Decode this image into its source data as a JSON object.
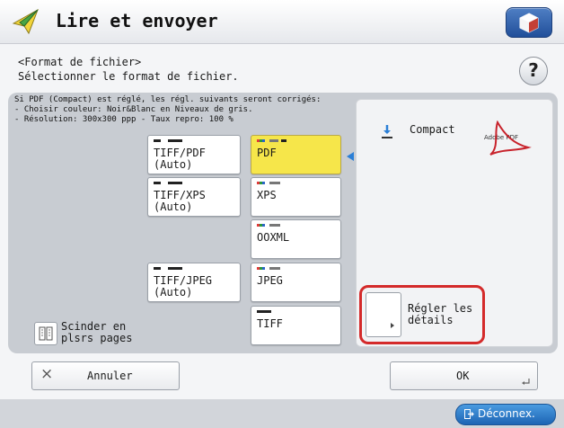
{
  "app": {
    "title": "Lire et envoyer"
  },
  "header": {
    "title": "<Format de fichier>",
    "subtitle": "Sélectionner le format de fichier.",
    "help_label": "?"
  },
  "info": {
    "line1": "Si PDF (Compact) est réglé, les régl. suivants seront corrigés:",
    "line2": "- Choisir couleur: Noir&Blanc en Niveaux de gris.",
    "line3": "- Résolution: 300x300 ppp - Taux repro: 100 %"
  },
  "formats": {
    "tiff_pdf": "TIFF/PDF\n(Auto)",
    "tiff_xps": "TIFF/XPS\n(Auto)",
    "tiff_jpeg": "TIFF/JPEG\n(Auto)",
    "pdf": "PDF",
    "xps": "XPS",
    "ooxml": "OOXML",
    "jpeg": "JPEG",
    "tiff": "TIFF",
    "selected": "PDF"
  },
  "split": {
    "label": "Scinder en\nplsrs pages"
  },
  "details": {
    "compact_label": "Compact",
    "pdf_logo_text": "Adobe PDF",
    "settings_button": "Régler les\ndétails"
  },
  "footer": {
    "cancel": "Annuler",
    "cancel_icon": "×",
    "ok": "OK",
    "logout": "Déconnex."
  },
  "colors": {
    "selected": "#f6e64a",
    "highlight": "#d42a2a",
    "accent": "#2b7fd6"
  },
  "icons": {
    "title": "send-arrow-icon",
    "top_right": "gem-icon",
    "compact": "download-arrow-icon",
    "split": "split-pages-icon",
    "logout": "logout-icon"
  }
}
